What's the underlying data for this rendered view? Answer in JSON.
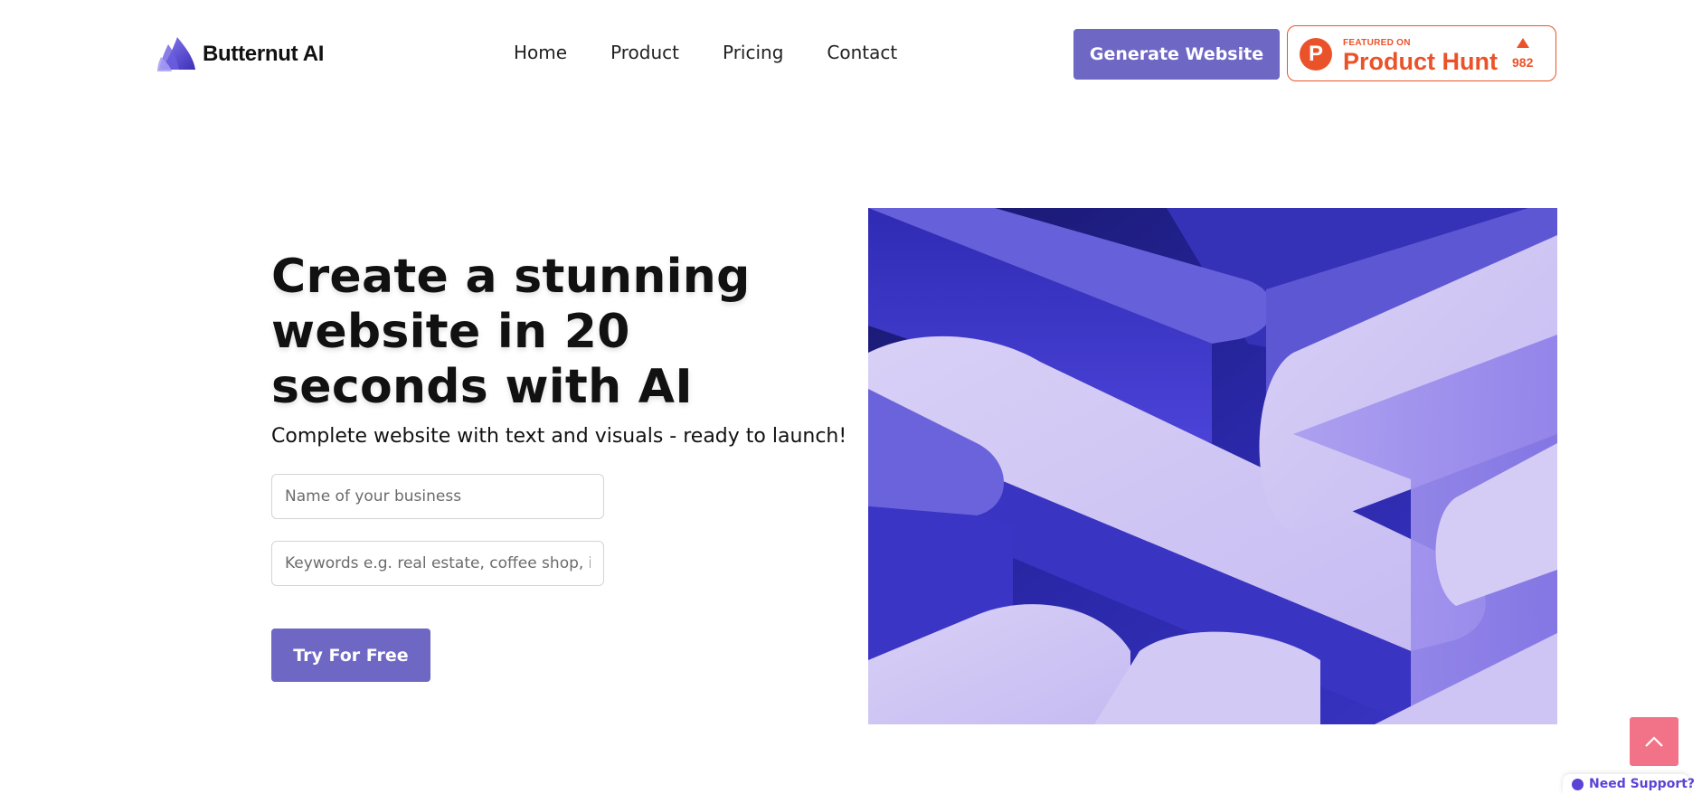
{
  "brand": {
    "name": "Butternut AI",
    "logo_icon": "butternut-logo-icon"
  },
  "nav": {
    "items": [
      {
        "label": "Home"
      },
      {
        "label": "Product"
      },
      {
        "label": "Pricing"
      },
      {
        "label": "Contact"
      }
    ]
  },
  "header": {
    "generate_label": "Generate Website",
    "product_hunt": {
      "featured": "FEATURED ON",
      "name": "Product Hunt",
      "letter": "P",
      "upvotes": "982",
      "color": "#ea532a"
    }
  },
  "hero": {
    "title": "Create a stunning website in 20 seconds with AI",
    "subtitle": "Complete website with text and visuals - ready to launch!",
    "business_placeholder": "Name of your business",
    "keywords_placeholder": "Keywords e.g. real estate, coffee shop, immigration",
    "cta_label": "Try For Free",
    "image_icon": "abstract-3d-shapes-image"
  },
  "widgets": {
    "scroll_top_icon": "chevron-up-icon",
    "support_label": "Need Support?",
    "support_icon": "chat-bubble-icon"
  },
  "colors": {
    "accent": "#6f67c4",
    "product_hunt": "#ea532a",
    "scroll_top": "#f27388",
    "support": "#5b43d6"
  }
}
